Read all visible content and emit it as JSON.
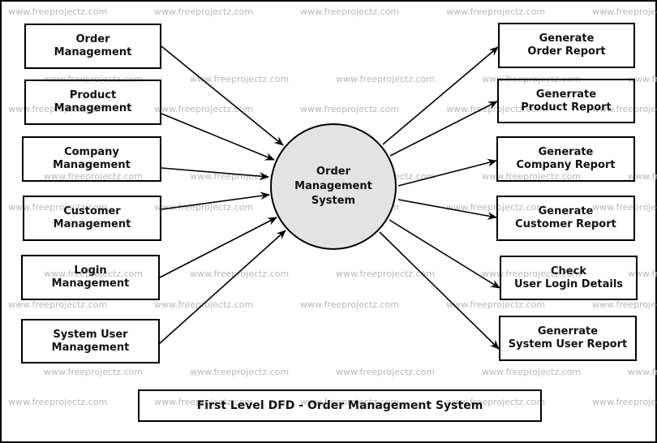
{
  "diagram": {
    "title": "First Level DFD - Order Management System",
    "central_process": {
      "lines": [
        "Order",
        "Management",
        "System"
      ],
      "fill": "#e3e3e3"
    },
    "inputs": [
      {
        "id": "order-management",
        "lines": [
          "Order",
          "Management"
        ]
      },
      {
        "id": "product-management",
        "lines": [
          "Product",
          "Management"
        ]
      },
      {
        "id": "company-management",
        "lines": [
          "Company",
          "Management"
        ]
      },
      {
        "id": "customer-management",
        "lines": [
          "Customer",
          "Management"
        ]
      },
      {
        "id": "login-management",
        "lines": [
          "Login",
          "Management"
        ]
      },
      {
        "id": "system-user-management",
        "lines": [
          "System User",
          "Management"
        ]
      }
    ],
    "outputs": [
      {
        "id": "generate-order-report",
        "lines": [
          "Generate",
          "Order Report"
        ]
      },
      {
        "id": "generate-product-report",
        "lines": [
          "Generrate",
          "Product Report"
        ]
      },
      {
        "id": "generate-company-report",
        "lines": [
          "Generate",
          "Company Report"
        ]
      },
      {
        "id": "generate-customer-report",
        "lines": [
          "Generate",
          "Customer Report"
        ]
      },
      {
        "id": "check-user-login-details",
        "lines": [
          "Check",
          "User Login Details"
        ]
      },
      {
        "id": "generate-system-user-report",
        "lines": [
          "Generrate",
          "System User Report"
        ]
      }
    ],
    "flows": [
      {
        "from": "order-management",
        "to": "central_process"
      },
      {
        "from": "product-management",
        "to": "central_process"
      },
      {
        "from": "company-management",
        "to": "central_process"
      },
      {
        "from": "customer-management",
        "to": "central_process"
      },
      {
        "from": "login-management",
        "to": "central_process"
      },
      {
        "from": "system-user-management",
        "to": "central_process"
      },
      {
        "from": "central_process",
        "to": "generate-order-report"
      },
      {
        "from": "central_process",
        "to": "generate-product-report"
      },
      {
        "from": "central_process",
        "to": "generate-company-report"
      },
      {
        "from": "central_process",
        "to": "generate-customer-report"
      },
      {
        "from": "central_process",
        "to": "check-user-login-details"
      },
      {
        "from": "central_process",
        "to": "generate-system-user-report"
      }
    ]
  },
  "watermark": {
    "text": "www.freeprojectz.com",
    "color": "#b8b8b8"
  }
}
